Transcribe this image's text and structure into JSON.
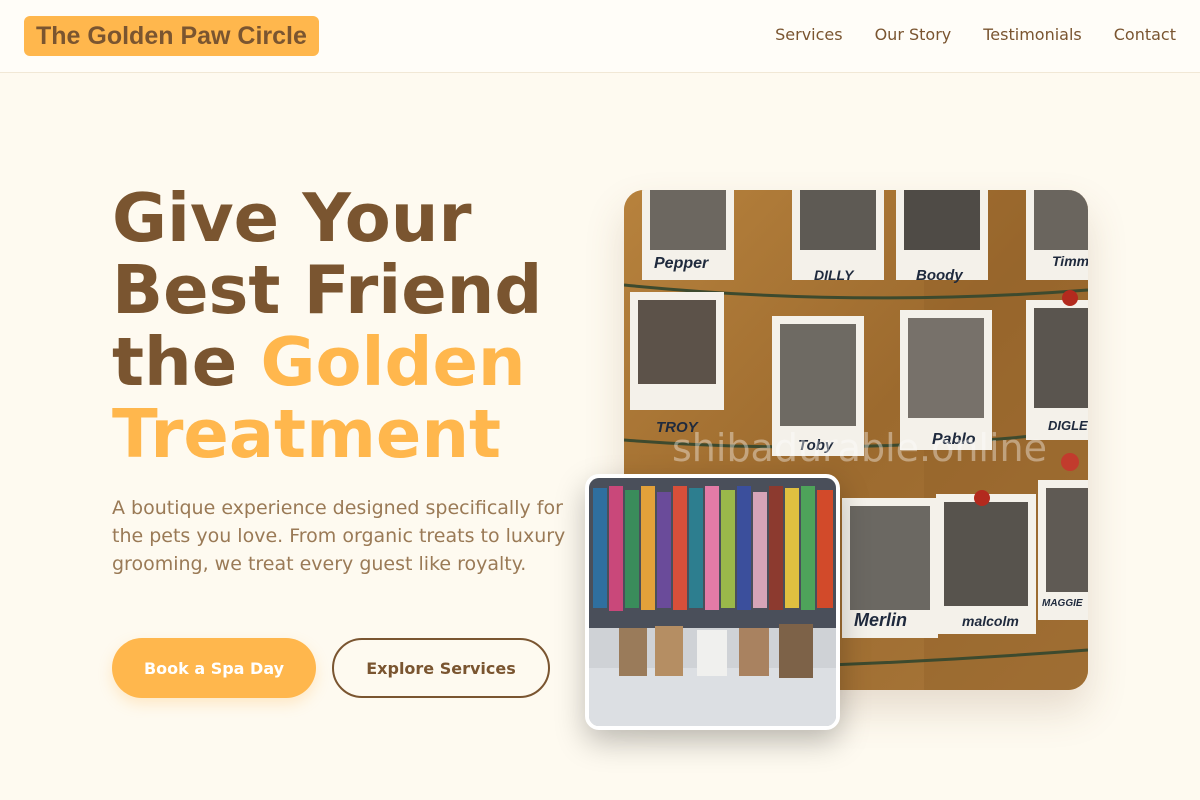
{
  "header": {
    "brand": "The Golden Paw Circle",
    "nav": [
      "Services",
      "Our Story",
      "Testimonials",
      "Contact"
    ]
  },
  "hero": {
    "title_lines": [
      "Give Your",
      "Best Friend",
      "the"
    ],
    "title_accent_inline": "Golden",
    "title_accent_last": "Treatment",
    "subtitle": "A boutique experience designed specifically for the pets you love. From organic treats to luxury grooming, we treat every guest like royalty.",
    "primary_button": "Book a Spa Day",
    "secondary_button": "Explore Services"
  },
  "images": {
    "main_watermark": "shibadurable.online",
    "main_alt": "Polaroid photos of dogs pinned on a string",
    "small_alt": "Pet shop interior with hanging pet clothes",
    "polaroid_names": [
      "Pepper",
      "DILLY",
      "Boody",
      "Timm",
      "TROY",
      "Toby",
      "Pablo",
      "DIGLE",
      "Merlin",
      "malcolm",
      "MAGGIE"
    ]
  },
  "colors": {
    "accent": "#ffb74d",
    "brown": "#7a5530",
    "background": "#fefaf0"
  }
}
